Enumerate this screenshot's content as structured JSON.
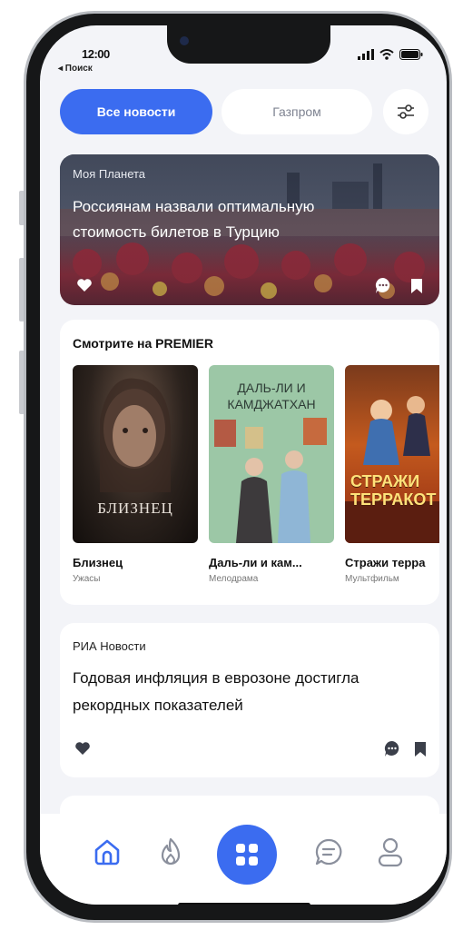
{
  "status_bar": {
    "time": "12:00",
    "back_label": "◂ Поиск"
  },
  "filters": {
    "active": "Все новости",
    "other": "Газпром"
  },
  "hero_news": {
    "source": "Моя Планета",
    "title": "Россиянам назвали оптимальную стоимость билетов в Турцию"
  },
  "premier": {
    "heading": "Смотрите на PREMIER",
    "movies": [
      {
        "title": "Близнец",
        "genre": "Ужасы",
        "poster_text": "БЛИЗНЕЦ"
      },
      {
        "title": "Даль-ли и кам...",
        "genre": "Мелодрама",
        "poster_text": "ДАЛЬ-ЛИ И КАМДЖАТХАН"
      },
      {
        "title": "Стражи терра",
        "genre": "Мультфильм",
        "poster_text": "СТРАЖИ ТЕРРАКОТ"
      }
    ]
  },
  "news_item": {
    "source": "РИА Новости",
    "title": "Годовая инфляция в еврозоне достигла рекордных показателей"
  },
  "tabbar": {
    "icons": [
      "home-icon",
      "fire-icon",
      "apps-grid-icon",
      "chat-icon",
      "profile-icon"
    ],
    "accent": "#3b6cf0"
  },
  "colors": {
    "accent": "#3b6cf0",
    "background": "#f3f4f8"
  }
}
